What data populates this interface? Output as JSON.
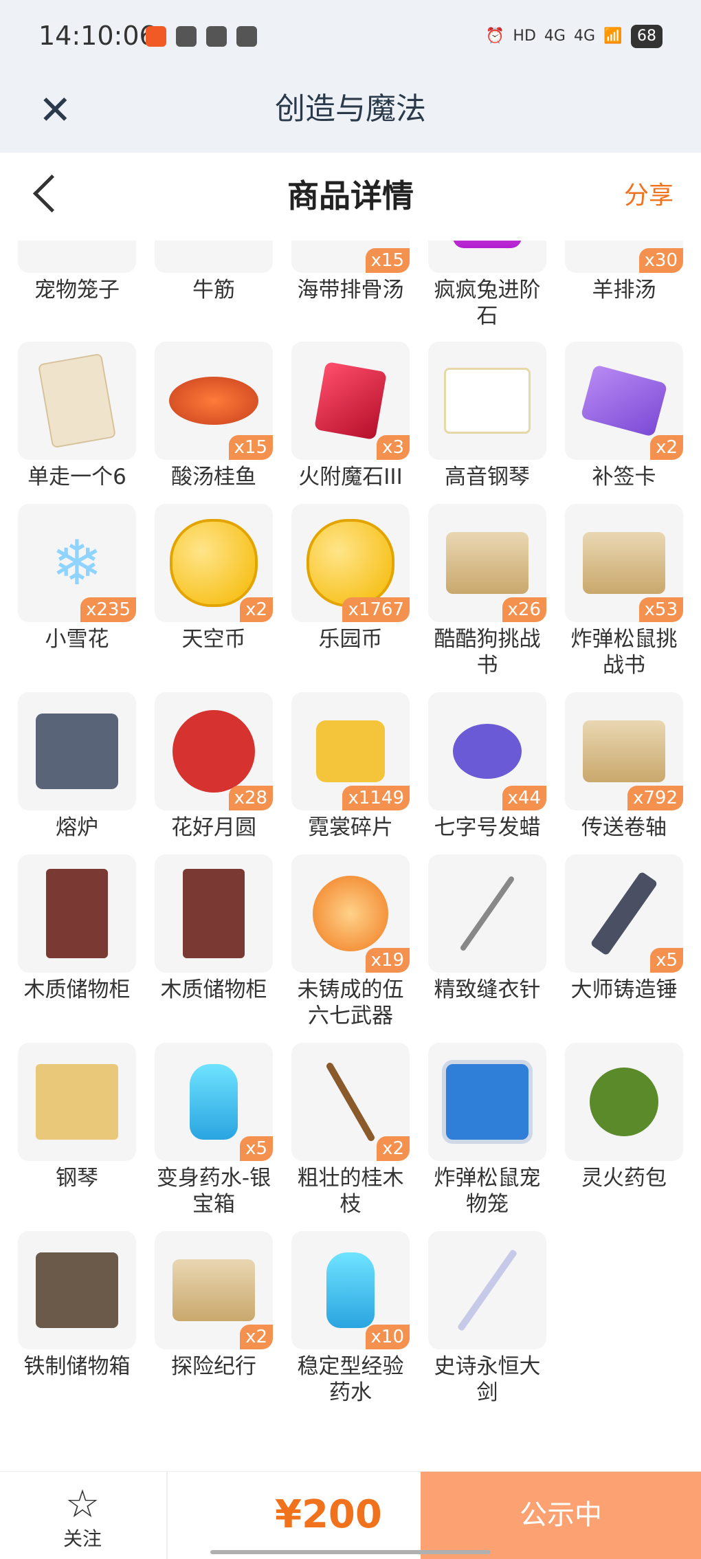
{
  "status_bar": {
    "time": "14:10:06",
    "battery": "68",
    "network1": "4G",
    "network2": "4G",
    "hd": "HD"
  },
  "miniprogram": {
    "title": "创造与魔法",
    "close_icon": "close-icon"
  },
  "header": {
    "title": "商品详情",
    "share": "分享"
  },
  "items": [
    {
      "name": "宠物笼子",
      "qty": "",
      "icon": "crate"
    },
    {
      "name": "牛筋",
      "qty": "",
      "icon": "rib"
    },
    {
      "name": "海带排骨汤",
      "qty": "x15",
      "icon": "bowl"
    },
    {
      "name": "疯疯兔进阶石",
      "qty": "",
      "icon": "hex"
    },
    {
      "name": "羊排汤",
      "qty": "x30",
      "icon": "bowl"
    },
    {
      "name": "单走一个6",
      "qty": "",
      "icon": "card"
    },
    {
      "name": "酸汤桂鱼",
      "qty": "x15",
      "icon": "dish"
    },
    {
      "name": "火附魔石III",
      "qty": "x3",
      "icon": "gem"
    },
    {
      "name": "高音钢琴",
      "qty": "",
      "icon": "piano"
    },
    {
      "name": "补签卡",
      "qty": "x2",
      "icon": "ticket"
    },
    {
      "name": "小雪花",
      "qty": "x235",
      "icon": "snow"
    },
    {
      "name": "天空币",
      "qty": "x2",
      "icon": "coin"
    },
    {
      "name": "乐园币",
      "qty": "x1767",
      "icon": "coin"
    },
    {
      "name": "酷酷狗挑战书",
      "qty": "x26",
      "icon": "scroll"
    },
    {
      "name": "炸弹松鼠挑战书",
      "qty": "x53",
      "icon": "scroll"
    },
    {
      "name": "熔炉",
      "qty": "",
      "icon": "furnace"
    },
    {
      "name": "花好月圆",
      "qty": "x28",
      "icon": "moon"
    },
    {
      "name": "霓裳碎片",
      "qty": "x1149",
      "icon": "shirt"
    },
    {
      "name": "七字号发蜡",
      "qty": "x44",
      "icon": "wax"
    },
    {
      "name": "传送卷轴",
      "qty": "x792",
      "icon": "scroll"
    },
    {
      "name": "木质储物柜",
      "qty": "",
      "icon": "cab"
    },
    {
      "name": "木质储物柜",
      "qty": "",
      "icon": "cab"
    },
    {
      "name": "未铸成的伍六七武器",
      "qty": "x19",
      "icon": "scissor"
    },
    {
      "name": "精致缝衣针",
      "qty": "",
      "icon": "needle"
    },
    {
      "name": "大师铸造锤",
      "qty": "x5",
      "icon": "hammer"
    },
    {
      "name": "钢琴",
      "qty": "",
      "icon": "piano2"
    },
    {
      "name": "变身药水-银宝箱",
      "qty": "x5",
      "icon": "bottle"
    },
    {
      "name": "粗壮的桂木枝",
      "qty": "x2",
      "icon": "branch"
    },
    {
      "name": "炸弹松鼠宠物笼",
      "qty": "",
      "icon": "cage"
    },
    {
      "name": "灵火药包",
      "qty": "",
      "icon": "bag"
    },
    {
      "name": "铁制储物箱",
      "qty": "",
      "icon": "box"
    },
    {
      "name": "探险纪行",
      "qty": "x2",
      "icon": "scroll"
    },
    {
      "name": "稳定型经验药水",
      "qty": "x10",
      "icon": "bottle"
    },
    {
      "name": "史诗永恒大剑",
      "qty": "",
      "icon": "sword"
    }
  ],
  "bottom_bar": {
    "follow_label": "关注",
    "price": "¥200",
    "status_button": "公示中"
  }
}
